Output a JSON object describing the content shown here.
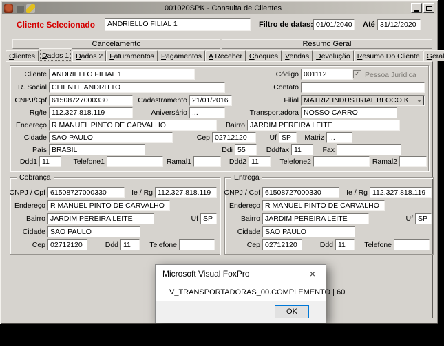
{
  "colors": {
    "selected_client_red": "#d40000",
    "window_bg": "#d6d3ce",
    "dialog_accent": "#0078d7"
  },
  "titlebar": {
    "title": "001020SPK - Consulta de Clientes"
  },
  "icons": {
    "fox": "fox-app",
    "paw": "paw-print",
    "wrench": "wrench-tool",
    "minimize": "css-bar",
    "maximize": "css-box",
    "close": "×",
    "dropdown": "▼",
    "check": "✓"
  },
  "header": {
    "selected_label": "Cliente Selecionado",
    "selected_value": "ANDRIELLO FILIAL 1",
    "filter_label": "Filtro de datas:",
    "date_from": "01/01/2040",
    "until_label": "Até",
    "date_to": "31/12/2020"
  },
  "sections": {
    "cancelamento": "Cancelamento",
    "resumo_geral": "Resumo Geral"
  },
  "tabs": [
    "Clientes",
    "Dados 1",
    "Dados 2",
    "Faturamentos",
    "Pagamentos",
    "A Receber",
    "Cheques",
    "Vendas",
    "Devolução",
    "Resumo Do Cliente",
    "Geral"
  ],
  "active_tab": "Dados 1",
  "main": {
    "cliente": {
      "label": "Cliente",
      "value": "ANDRIELLO FILIAL 1"
    },
    "codigo": {
      "label": "Código",
      "value": "001112"
    },
    "pessoa_juridica": {
      "label": "Pessoa Jurídica",
      "checked": true
    },
    "rsocial": {
      "label": "R. Social",
      "value": "CLIENTE ANDRITTO"
    },
    "contato": {
      "label": "Contato",
      "value": ""
    },
    "cnpj": {
      "label": "CNPJ/Cpf",
      "value": "61508727000330"
    },
    "cadastramento": {
      "label": "Cadastramento",
      "value": "21/01/2016"
    },
    "filial": {
      "label": "Filial",
      "value": "MATRIZ INDUSTRIAL BLOCO K"
    },
    "rgie": {
      "label": "Rg/Ie",
      "value": "112.327.818.119"
    },
    "aniversario": {
      "label": "Aniversário",
      "value": "..."
    },
    "transportadora": {
      "label": "Transportadora",
      "value": "NOSSO CARRO"
    },
    "endereco": {
      "label": "Endereço",
      "value": "R MANUEL PINTO DE CARVALHO"
    },
    "bairro": {
      "label": "Bairro",
      "value": "JARDIM PEREIRA LEITE"
    },
    "cidade": {
      "label": "Cidade",
      "value": "SAO PAULO"
    },
    "cep": {
      "label": "Cep",
      "value": "02712120"
    },
    "uf": {
      "label": "Uf",
      "value": "SP"
    },
    "matriz": {
      "label": "Matriz",
      "value": "..."
    },
    "pais": {
      "label": "País",
      "value": "BRASIL"
    },
    "ddi": {
      "label": "Ddi",
      "value": "55"
    },
    "dddfax": {
      "label": "Dddfax",
      "value": "11"
    },
    "fax": {
      "label": "Fax",
      "value": ""
    },
    "ddd1": {
      "label": "Ddd1",
      "value": "11"
    },
    "telefone1": {
      "label": "Telefone1",
      "value": ""
    },
    "ramal1": {
      "label": "Ramal1",
      "value": ""
    },
    "ddd2": {
      "label": "Ddd2",
      "value": "11"
    },
    "telefone2": {
      "label": "Telefone2",
      "value": ""
    },
    "ramal2": {
      "label": "Ramal2",
      "value": ""
    }
  },
  "cobranca": {
    "title": "Cobrança",
    "cnpj": {
      "label": "CNPJ / Cpf",
      "value": "61508727000330"
    },
    "ierg": {
      "label": "Ie / Rg",
      "value": "112.327.818.119"
    },
    "endereco": {
      "label": "Endereço",
      "value": "R MANUEL PINTO DE CARVALHO"
    },
    "bairro": {
      "label": "Bairro",
      "value": "JARDIM PEREIRA LEITE"
    },
    "uf": {
      "label": "Uf",
      "value": "SP"
    },
    "cidade": {
      "label": "Cidade",
      "value": "SAO PAULO"
    },
    "cep": {
      "label": "Cep",
      "value": "02712120"
    },
    "ddd": {
      "label": "Ddd",
      "value": "11"
    },
    "telefone": {
      "label": "Telefone",
      "value": ""
    }
  },
  "entrega": {
    "title": "Entrega",
    "cnpj": {
      "label": "CNPJ / Cpf",
      "value": "61508727000330"
    },
    "ierg": {
      "label": "Ie / Rg",
      "value": "112.327.818.119"
    },
    "endereco": {
      "label": "Endereço",
      "value": "R MANUEL PINTO DE CARVALHO"
    },
    "bairro": {
      "label": "Bairro",
      "value": "JARDIM PEREIRA LEITE"
    },
    "uf": {
      "label": "Uf",
      "value": "SP"
    },
    "cidade": {
      "label": "Cidade",
      "value": "SAO PAULO"
    },
    "cep": {
      "label": "Cep",
      "value": "02712120"
    },
    "ddd": {
      "label": "Ddd",
      "value": "11"
    },
    "telefone": {
      "label": "Telefone",
      "value": ""
    }
  },
  "dialog": {
    "title": "Microsoft Visual FoxPro",
    "message": "V_TRANSPORTADORAS_00.COMPLEMENTO | 60",
    "ok": "OK"
  }
}
